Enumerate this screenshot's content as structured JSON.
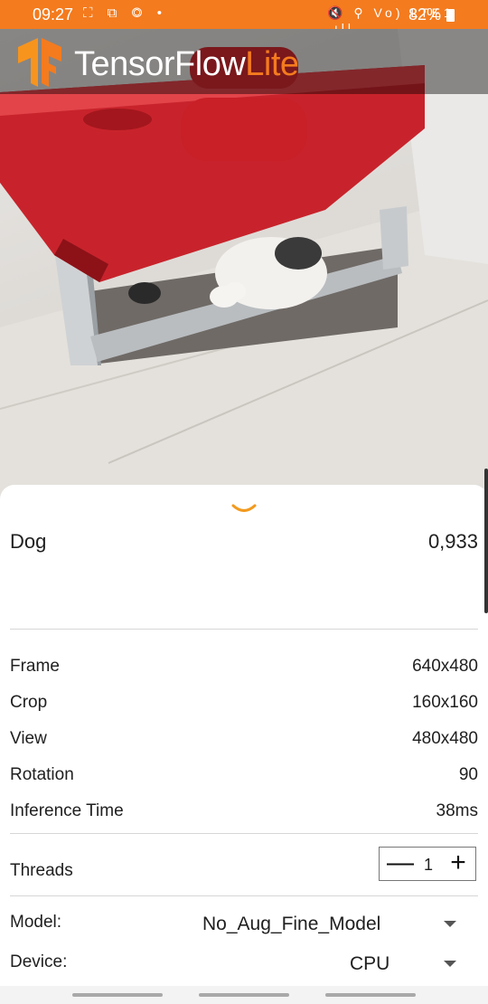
{
  "status_bar": {
    "time": "09:27",
    "left_icons": "⛶ ⧉ ◎ •",
    "right_icons": "🔇 ⚲ Vo) LTE1 .ıll",
    "battery": "82%"
  },
  "app": {
    "logo_word": "TensorFlow",
    "logo_suffix": "Lite",
    "accent_color": "#f47b1e"
  },
  "result": {
    "label": "Dog",
    "score": "0,933"
  },
  "info": {
    "frame": {
      "label": "Frame",
      "value": "640x480"
    },
    "crop": {
      "label": "Crop",
      "value": "160x160"
    },
    "view": {
      "label": "View",
      "value": "480x480"
    },
    "rotation": {
      "label": "Rotation",
      "value": "90"
    },
    "inference": {
      "label": "Inference Time",
      "value": "38ms"
    }
  },
  "threads": {
    "label": "Threads",
    "minus": "—",
    "count": "1",
    "plus": "+"
  },
  "model": {
    "label": "Model:",
    "value": "No_Aug_Fine_Model"
  },
  "device": {
    "label": "Device:",
    "value": "CPU"
  },
  "icons": [
    "chevron-down-icon",
    "minus-icon",
    "plus-icon",
    "dropdown-arrow-icon",
    "battery-icon",
    "tensorflow-logo-icon"
  ]
}
